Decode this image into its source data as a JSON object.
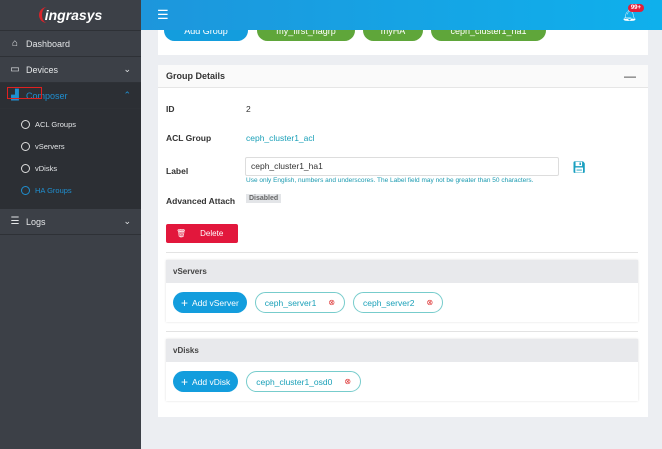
{
  "brand": "ingrasys",
  "sidebar": {
    "items": [
      {
        "label": "Dashboard",
        "icon": "home-icon"
      },
      {
        "label": "Devices",
        "icon": "monitor-icon"
      },
      {
        "label": "Composer",
        "icon": "chart-icon",
        "active": true
      },
      {
        "label": "Logs",
        "icon": "list-icon"
      }
    ],
    "composer_sub": [
      "ACL Groups",
      "vServers",
      "vDisks",
      "HA Groups"
    ]
  },
  "topbar": {
    "notification_count": "99+"
  },
  "groups": {
    "add_label": "Add Group",
    "items": [
      "my_first_hagrp",
      "myHA",
      "ceph_cluster1_ha1"
    ]
  },
  "details": {
    "title": "Group Details",
    "collapse": "—",
    "id_label": "ID",
    "id": "2",
    "acl_label": "ACL Group",
    "acl": "ceph_cluster1_acl",
    "label_label": "Label",
    "label_value": "ceph_cluster1_ha1",
    "hint": "Use only English, numbers and underscores.  The Label field may not be greater than 50 characters.",
    "adv_label": "Advanced Attach",
    "adv_value": "Disabled",
    "delete": "Delete"
  },
  "vservers": {
    "title": "vServers",
    "add": "Add vServer",
    "items": [
      "ceph_server1",
      "ceph_server2"
    ]
  },
  "vdisks": {
    "title": "vDisks",
    "add": "Add vDisk",
    "items": [
      "ceph_cluster1_osd0"
    ]
  },
  "colors": {
    "accent": "#139ddd",
    "danger": "#e2173c",
    "success": "#5fa63a",
    "sidebar": "#3c4047"
  }
}
